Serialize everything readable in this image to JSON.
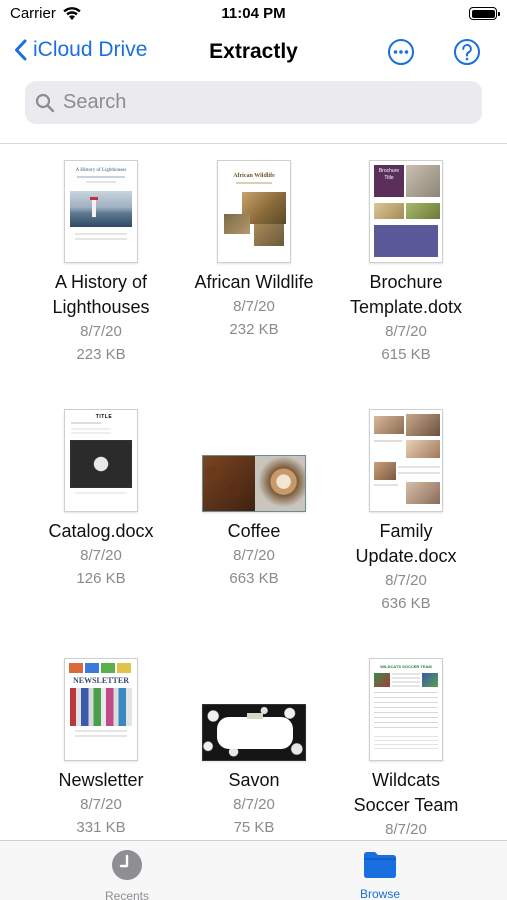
{
  "status_bar": {
    "carrier": "Carrier",
    "time": "11:04 PM"
  },
  "nav": {
    "back_label": "iCloud Drive",
    "title": "Extractly"
  },
  "search": {
    "placeholder": "Search",
    "value": ""
  },
  "files": [
    {
      "name_lines": [
        "A History of",
        "Lighthouses"
      ],
      "date": "8/7/20",
      "size": "223 KB",
      "thumb": "document-thumbnail",
      "thumb_text": [
        "A History of Lighthouses"
      ]
    },
    {
      "name_lines": [
        "African Wildlife"
      ],
      "date": "8/7/20",
      "size": "232 KB",
      "thumb": "document-thumbnail",
      "thumb_text": [
        "African Wildlife"
      ]
    },
    {
      "name_lines": [
        "Brochure",
        "Template.dotx"
      ],
      "date": "8/7/20",
      "size": "615 KB",
      "thumb": "document-thumbnail",
      "thumb_text": [
        "Brochure",
        "Title"
      ]
    },
    {
      "name_lines": [
        "Catalog.docx"
      ],
      "date": "8/7/20",
      "size": "126 KB",
      "thumb": "document-thumbnail",
      "thumb_text": [
        "TITLE"
      ]
    },
    {
      "name_lines": [
        "Coffee"
      ],
      "date": "8/7/20",
      "size": "663 KB",
      "thumb": "image-thumbnail",
      "thumb_text": []
    },
    {
      "name_lines": [
        "Family",
        "Update.docx"
      ],
      "date": "8/7/20",
      "size": "636 KB",
      "thumb": "document-thumbnail",
      "thumb_text": []
    },
    {
      "name_lines": [
        "Newsletter"
      ],
      "date": "8/7/20",
      "size": "331 KB",
      "thumb": "document-thumbnail",
      "thumb_text": [
        "NEWSLETTER"
      ]
    },
    {
      "name_lines": [
        "Savon"
      ],
      "date": "8/7/20",
      "size": "75 KB",
      "thumb": "image-thumbnail",
      "thumb_text": []
    },
    {
      "name_lines": [
        "Wildcats",
        "Soccer Team"
      ],
      "date": "8/7/20",
      "size": "",
      "thumb": "document-thumbnail",
      "thumb_text": [
        "WILDCATS SOCCER TEAM"
      ]
    }
  ],
  "tabs": [
    {
      "label": "Recents",
      "icon": "clock-icon",
      "selected": false
    },
    {
      "label": "Browse",
      "icon": "folder-icon",
      "selected": true
    }
  ],
  "colors": {
    "accent": "#1a6fe0",
    "inactive_tab": "#8e8e93",
    "secondary_text": "#8a8a8f"
  }
}
